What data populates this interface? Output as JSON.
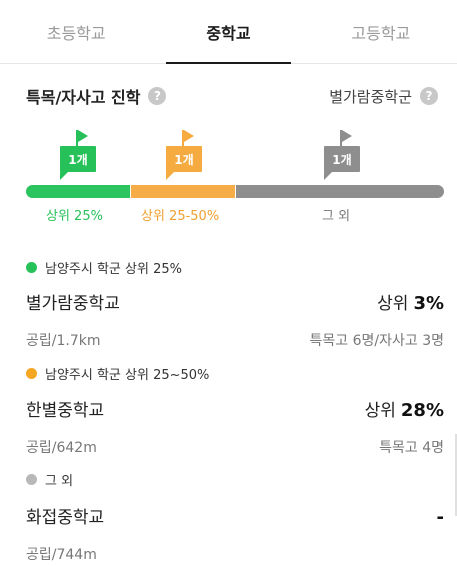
{
  "tabs": [
    {
      "label": "초등학교",
      "active": false
    },
    {
      "label": "중학교",
      "active": true
    },
    {
      "label": "고등학교",
      "active": false
    }
  ],
  "section": {
    "title": "특목/자사고 진학",
    "school_group": "별가람중학군",
    "help_icon": "question-circle-icon"
  },
  "distribution": {
    "flags": [
      {
        "label": "1개",
        "color": "#27c15a"
      },
      {
        "label": "1개",
        "color": "#f5ab3f"
      },
      {
        "label": "1개",
        "color": "#8e8e8e"
      }
    ],
    "segments": [
      {
        "label": "상위 25%",
        "color": "#2cc45f"
      },
      {
        "label": "상위 25-50%",
        "color": "#f6ad48"
      },
      {
        "label": "그 외",
        "color": "#8e8e8e"
      }
    ]
  },
  "groups": [
    {
      "heading": "남양주시 학군 상위 25%",
      "dot_color": "#27c15a",
      "school": {
        "name": "별가람중학교",
        "rank_prefix": "상위",
        "rank_value": "3%",
        "info": "공립/1.7km",
        "stats": "특목고 6명/자사고 3명"
      }
    },
    {
      "heading": "남양주시 학군 상위 25~50%",
      "dot_color": "#f5a623",
      "school": {
        "name": "한별중학교",
        "rank_prefix": "상위",
        "rank_value": "28%",
        "info": "공립/642m",
        "stats": "특목고 4명"
      }
    },
    {
      "heading": "그 외",
      "dot_color": "#b8b8b8",
      "school": {
        "name": "화접중학교",
        "rank_prefix": "",
        "rank_value": "-",
        "info": "공립/744m",
        "stats": ""
      }
    }
  ]
}
